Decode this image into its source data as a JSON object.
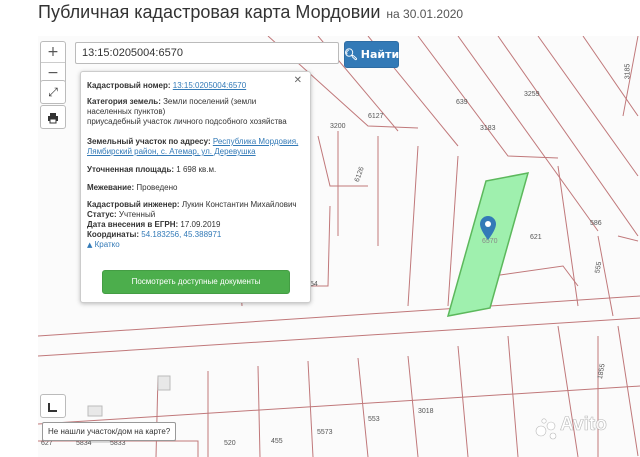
{
  "header": {
    "title": "Публичная кадастровая карта Мордовии",
    "date": "на 30.01.2020"
  },
  "search": {
    "value": "13:15:0205004:6570",
    "button_label": "Найти"
  },
  "controls": {
    "zoom_in": "+",
    "zoom_out": "−"
  },
  "popup": {
    "cadastral_number_label": "Кадастровый номер:",
    "cadastral_number": "13:15:0205004:6570",
    "land_category_label": "Категория земель:",
    "land_category": "Земли поселений (земли",
    "land_category_2": "населенных пунктов)",
    "land_use": "приусадебный участок личного подсобного хозяйства",
    "address_label": "Земельный участок по адресу:",
    "address_1": "Республика Мордовия,",
    "address_2": "Лямбирский район, с. Атемар, ул. Деревушка",
    "area_label": "Уточненная площадь:",
    "area": "1 698 кв.м.",
    "survey_label": "Межевание:",
    "survey": "Проведено",
    "engineer_label": "Кадастровый инженер:",
    "engineer": "Лукин Константин Михайлович",
    "status_label": "Статус:",
    "status": "Учтенный",
    "egrn_label": "Дата внесения в ЕГРН:",
    "egrn_date": "17.09.2019",
    "coords_label": "Координаты:",
    "coords": "54.183256, 45.388971",
    "brief_link": "Кратко",
    "docs_button": "Посмотреть доступные документы"
  },
  "parcel_labels": [
    "639",
    "3259",
    "3183",
    "3200",
    "6127",
    "6126",
    "621",
    "586",
    "555",
    "553",
    "520",
    "455",
    "5573",
    "3018",
    "5834",
    "5833",
    "627",
    "3185",
    "1855",
    "6570",
    "54"
  ],
  "bottom": {
    "not_found": "Не нашли участок/дом на карте?"
  },
  "watermark": "Avito",
  "colors": {
    "accent": "#337ab7",
    "docs_button": "#4cae4c",
    "parcel_selected": "#9ff0ae",
    "parcel_lines": "#c0787a"
  }
}
